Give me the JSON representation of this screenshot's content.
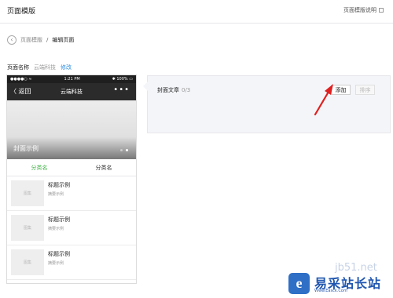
{
  "header": {
    "title": "页面模版",
    "help_link": "页面模版说明"
  },
  "breadcrumb": {
    "parent": "页面模版",
    "separator": "/",
    "current": "编辑页面"
  },
  "page_name": {
    "label": "页面名称",
    "value": "云端科技",
    "edit_link": "修改"
  },
  "phone": {
    "status": {
      "signal": "●●●●○ ≈",
      "time": "1:21 PM",
      "battery": "✱ 100% ▭"
    },
    "nav": {
      "back_label": "〈 返回",
      "title": "云端科技",
      "more": "•••"
    },
    "cover": {
      "text": "封面示例"
    },
    "tabs": [
      {
        "label": "分类名",
        "active": true
      },
      {
        "label": "分类名",
        "active": false
      }
    ],
    "articles": [
      {
        "thumb": "图集",
        "title": "标题示例",
        "summary": "摘要示例"
      },
      {
        "thumb": "图集",
        "title": "标题示例",
        "summary": "摘要示例"
      },
      {
        "thumb": "图集",
        "title": "标题示例",
        "summary": "摘要示例"
      }
    ]
  },
  "panel": {
    "label": "封面文章",
    "count": "0/3",
    "add_button": "添加",
    "sort_button": "排序"
  },
  "watermark": {
    "url": "jb51.net",
    "logo": "e",
    "name": "易采站长站",
    "sub": "Www.Easck.Com"
  },
  "colors": {
    "accent_green": "#44b549",
    "link_blue": "#2f8fe0",
    "annotation_red": "#e02020"
  }
}
